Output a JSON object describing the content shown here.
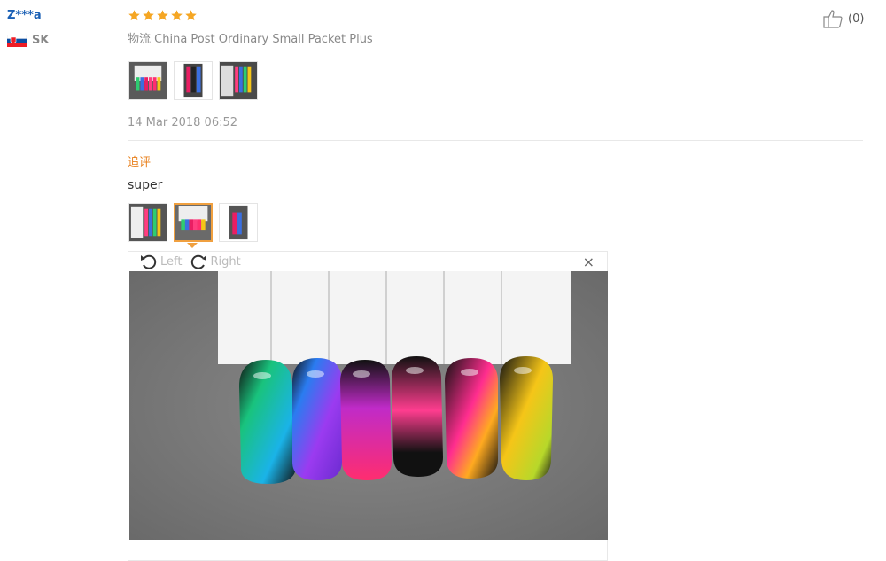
{
  "review": {
    "user": "Z***a",
    "country": "SK",
    "rating": 5,
    "logistics_label": "物流",
    "logistics_value": "China Post Ordinary Small Packet Plus",
    "likes": "(0)",
    "date": "14 Mar 2018 06:52",
    "followup_label": "追评",
    "followup_text": "super",
    "viewer": {
      "left_label": "Left",
      "right_label": "Right",
      "close_glyph": "×"
    }
  },
  "colors": {
    "user_link": "#1a5fb4",
    "star": "#f5a623",
    "followup": "#e8801c",
    "active_thumb": "#f0a040"
  }
}
